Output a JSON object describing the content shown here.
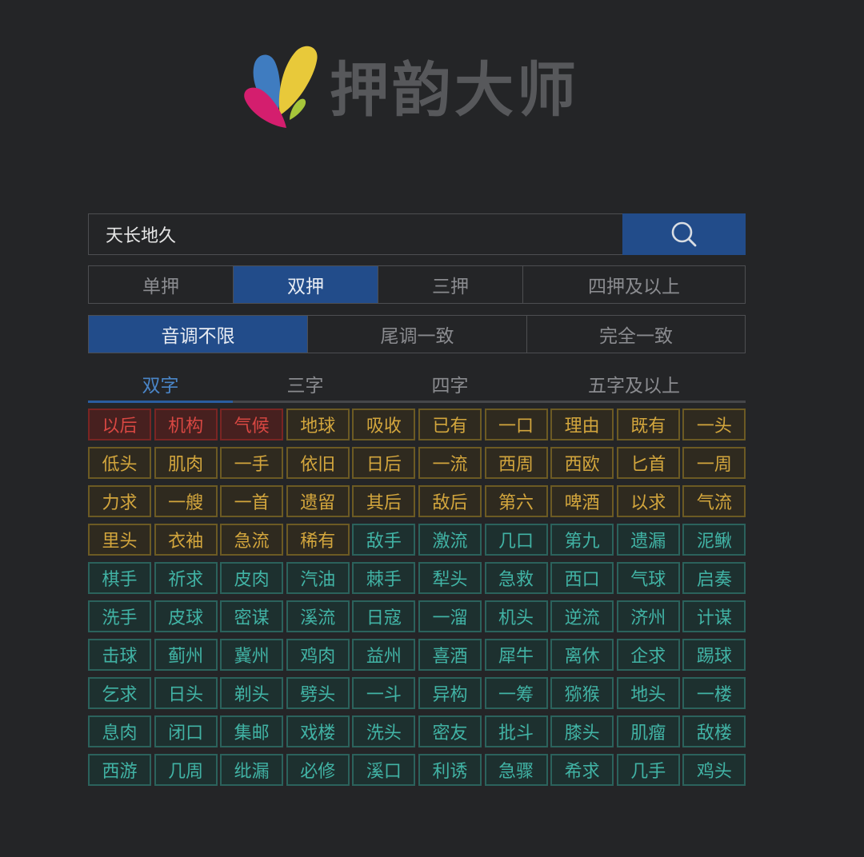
{
  "app": {
    "title": "押韵大师"
  },
  "colors": {
    "accent": "#224c8a",
    "tab_active": "#4a85c7",
    "red": "#d84742",
    "gold": "#d3a63d",
    "teal": "#41b3a5"
  },
  "search": {
    "value": "天长地久",
    "button_icon": "search-icon"
  },
  "rhyme_modes": [
    "单押",
    "双押",
    "三押",
    "四押及以上"
  ],
  "rhyme_mode_selected": "双押",
  "tone_modes": [
    "音调不限",
    "尾调一致",
    "完全一致"
  ],
  "tone_mode_selected": "音调不限",
  "length_tabs": [
    "双字",
    "三字",
    "四字",
    "五字及以上"
  ],
  "length_tab_selected": "双字",
  "results": [
    {
      "word": "以后",
      "level": "red"
    },
    {
      "word": "机构",
      "level": "red"
    },
    {
      "word": "气候",
      "level": "red"
    },
    {
      "word": "地球",
      "level": "gold"
    },
    {
      "word": "吸收",
      "level": "gold"
    },
    {
      "word": "已有",
      "level": "gold"
    },
    {
      "word": "一口",
      "level": "gold"
    },
    {
      "word": "理由",
      "level": "gold"
    },
    {
      "word": "既有",
      "level": "gold"
    },
    {
      "word": "一头",
      "level": "gold"
    },
    {
      "word": "低头",
      "level": "gold"
    },
    {
      "word": "肌肉",
      "level": "gold"
    },
    {
      "word": "一手",
      "level": "gold"
    },
    {
      "word": "依旧",
      "level": "gold"
    },
    {
      "word": "日后",
      "level": "gold"
    },
    {
      "word": "一流",
      "level": "gold"
    },
    {
      "word": "西周",
      "level": "gold"
    },
    {
      "word": "西欧",
      "level": "gold"
    },
    {
      "word": "匕首",
      "level": "gold"
    },
    {
      "word": "一周",
      "level": "gold"
    },
    {
      "word": "力求",
      "level": "gold"
    },
    {
      "word": "一艘",
      "level": "gold"
    },
    {
      "word": "一首",
      "level": "gold"
    },
    {
      "word": "遗留",
      "level": "gold"
    },
    {
      "word": "其后",
      "level": "gold"
    },
    {
      "word": "敌后",
      "level": "gold"
    },
    {
      "word": "第六",
      "level": "gold"
    },
    {
      "word": "啤酒",
      "level": "gold"
    },
    {
      "word": "以求",
      "level": "gold"
    },
    {
      "word": "气流",
      "level": "gold"
    },
    {
      "word": "里头",
      "level": "gold"
    },
    {
      "word": "衣袖",
      "level": "gold"
    },
    {
      "word": "急流",
      "level": "gold"
    },
    {
      "word": "稀有",
      "level": "gold"
    },
    {
      "word": "敌手",
      "level": "teal"
    },
    {
      "word": "激流",
      "level": "teal"
    },
    {
      "word": "几口",
      "level": "teal"
    },
    {
      "word": "第九",
      "level": "teal"
    },
    {
      "word": "遗漏",
      "level": "teal"
    },
    {
      "word": "泥鳅",
      "level": "teal"
    },
    {
      "word": "棋手",
      "level": "teal"
    },
    {
      "word": "祈求",
      "level": "teal"
    },
    {
      "word": "皮肉",
      "level": "teal"
    },
    {
      "word": "汽油",
      "level": "teal"
    },
    {
      "word": "棘手",
      "level": "teal"
    },
    {
      "word": "犁头",
      "level": "teal"
    },
    {
      "word": "急救",
      "level": "teal"
    },
    {
      "word": "西口",
      "level": "teal"
    },
    {
      "word": "气球",
      "level": "teal"
    },
    {
      "word": "启奏",
      "level": "teal"
    },
    {
      "word": "洗手",
      "level": "teal"
    },
    {
      "word": "皮球",
      "level": "teal"
    },
    {
      "word": "密谋",
      "level": "teal"
    },
    {
      "word": "溪流",
      "level": "teal"
    },
    {
      "word": "日寇",
      "level": "teal"
    },
    {
      "word": "一溜",
      "level": "teal"
    },
    {
      "word": "机头",
      "level": "teal"
    },
    {
      "word": "逆流",
      "level": "teal"
    },
    {
      "word": "济州",
      "level": "teal"
    },
    {
      "word": "计谋",
      "level": "teal"
    },
    {
      "word": "击球",
      "level": "teal"
    },
    {
      "word": "蓟州",
      "level": "teal"
    },
    {
      "word": "冀州",
      "level": "teal"
    },
    {
      "word": "鸡肉",
      "level": "teal"
    },
    {
      "word": "益州",
      "level": "teal"
    },
    {
      "word": "喜酒",
      "level": "teal"
    },
    {
      "word": "犀牛",
      "level": "teal"
    },
    {
      "word": "离休",
      "level": "teal"
    },
    {
      "word": "企求",
      "level": "teal"
    },
    {
      "word": "踢球",
      "level": "teal"
    },
    {
      "word": "乞求",
      "level": "teal"
    },
    {
      "word": "日头",
      "level": "teal"
    },
    {
      "word": "剃头",
      "level": "teal"
    },
    {
      "word": "劈头",
      "level": "teal"
    },
    {
      "word": "一斗",
      "level": "teal"
    },
    {
      "word": "异构",
      "level": "teal"
    },
    {
      "word": "一筹",
      "level": "teal"
    },
    {
      "word": "猕猴",
      "level": "teal"
    },
    {
      "word": "地头",
      "level": "teal"
    },
    {
      "word": "一楼",
      "level": "teal"
    },
    {
      "word": "息肉",
      "level": "teal"
    },
    {
      "word": "闭口",
      "level": "teal"
    },
    {
      "word": "集邮",
      "level": "teal"
    },
    {
      "word": "戏楼",
      "level": "teal"
    },
    {
      "word": "洗头",
      "level": "teal"
    },
    {
      "word": "密友",
      "level": "teal"
    },
    {
      "word": "批斗",
      "level": "teal"
    },
    {
      "word": "膝头",
      "level": "teal"
    },
    {
      "word": "肌瘤",
      "level": "teal"
    },
    {
      "word": "敌楼",
      "level": "teal"
    },
    {
      "word": "西游",
      "level": "teal"
    },
    {
      "word": "几周",
      "level": "teal"
    },
    {
      "word": "纰漏",
      "level": "teal"
    },
    {
      "word": "必修",
      "level": "teal"
    },
    {
      "word": "溪口",
      "level": "teal"
    },
    {
      "word": "利诱",
      "level": "teal"
    },
    {
      "word": "急骤",
      "level": "teal"
    },
    {
      "word": "希求",
      "level": "teal"
    },
    {
      "word": "几手",
      "level": "teal"
    },
    {
      "word": "鸡头",
      "level": "teal"
    }
  ]
}
